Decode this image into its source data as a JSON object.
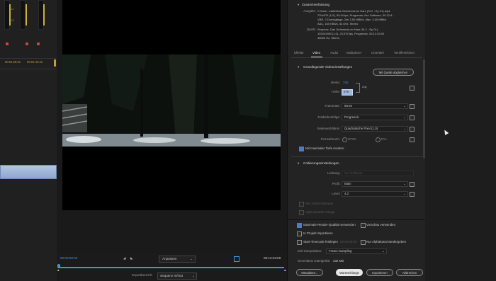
{
  "left": {
    "timecodes": [
      "00:01:29:21",
      "00:01:44:21"
    ],
    "meter_scale": [
      "-12",
      "-24"
    ]
  },
  "preview": {
    "current_time": "00:00:00:00",
    "end_time": "00:12:43:00",
    "fit_label": "Anpassen",
    "export_range_label": "Exportbereich:",
    "export_range_value": "Sequenz In/Out"
  },
  "summary": {
    "title": "Zusammenfassung",
    "output_label": "Ausgabe:",
    "output_lines": [
      "C:\\User...eatts\\Das Geheimnis im Harz (St 2 - Ep 01).mp4",
      "720x576 (1,0), 59,94 fps, Progressiv, Nur Software, 00:12:4...",
      "VBR, 2 Durchgänge, Ziel 3,50 MBit/s, Max. 4,00 MBit/s",
      "AAC, 160 KBit/s, 44 kHz, Stereo"
    ],
    "source_label": "Quelle:",
    "source_lines": [
      "Sequenz, Das Geheimnis im Harz (St 2 - Ep 01)",
      "1920x1080 (1,0), 23,976 fps, Progressiv, 00:12:43:00",
      "48000 Hz, Stereo"
    ]
  },
  "tabs": [
    "Effekte",
    "Video",
    "Audio",
    "Multiplexer",
    "Untertitel",
    "Veröffentlichen"
  ],
  "basic": {
    "title": "Grundlegende Videoeinstellungen",
    "match_source": "Mit Quelle abgleichen",
    "width_label": "Breite:",
    "width_value": "720",
    "height_label": "Höhe:",
    "height_value": "576",
    "link_text": "Zoy",
    "framerate_label": "Framerate:",
    "framerate_value": "59,94",
    "field_order_label": "Feldreihenfolge:",
    "field_order_value": "Progressiv",
    "aspect_label": "Seitenverhältnis:",
    "aspect_value": "Quadratische Pixel (1,0)",
    "tv_label": "Fernsehnorm:",
    "ntsc": "NTSC",
    "pal": "PAL",
    "max_depth": "Mit maximaler Tiefe rendern"
  },
  "encoding": {
    "title": "Codierungseinstellungen",
    "perf_label": "Leistung:",
    "perf_value": "Nur Software",
    "profile_label": "Profil:",
    "profile_value": "Main",
    "level_label": "Level:",
    "level_value": "4.2",
    "rec2020": "Rec.2020-Farbraum",
    "hdr": "High Dynamic Range"
  },
  "bottom": {
    "max_quality": "Maximale Render-Qualität verwenden",
    "use_previews": "Vorschau verwenden",
    "import_project": "In Projekt importieren",
    "start_tc": "Start-Timecode festlegen",
    "start_tc_value": "00:00:00:00",
    "alpha_only": "Nur Alphakanal wiedergeben",
    "interp_label": "Zeit-Interpolation:",
    "interp_value": "Frame-Sampling",
    "filesize_label": "Geschätzte Dateigröße:",
    "filesize_value": "332 MB",
    "buttons": [
      "Metadaten...",
      "Warteschlange",
      "Exportieren",
      "Abbrechen"
    ]
  },
  "colors": {
    "accent": "#4b8fe0",
    "timecode": "#c79a3a",
    "highlight": "#4d7bc4"
  }
}
